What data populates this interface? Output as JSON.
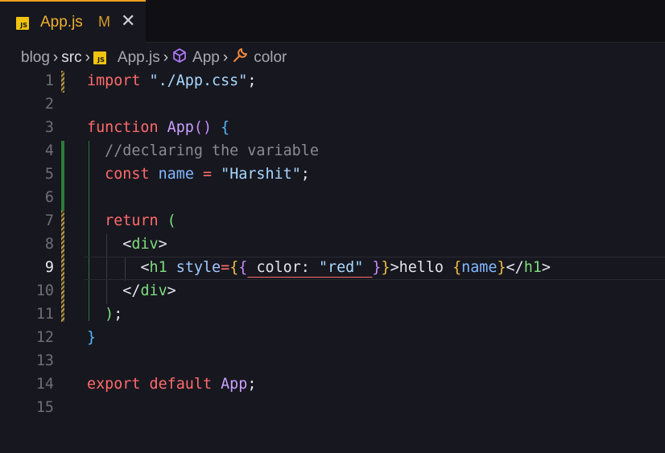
{
  "tab": {
    "icon": "JS",
    "label": "App.js",
    "status": "M",
    "close": "✕"
  },
  "breadcrumb": {
    "items": [
      "blog",
      "src",
      "App.js",
      "App",
      "color"
    ]
  },
  "editor": {
    "active_line": 9,
    "lines": [
      {
        "n": "1",
        "text": "import \"./App.css\";"
      },
      {
        "n": "2",
        "text": ""
      },
      {
        "n": "3",
        "text": "function App() {"
      },
      {
        "n": "4",
        "text": "  //declaring the variable"
      },
      {
        "n": "5",
        "text": "  const name = \"Harshit\";"
      },
      {
        "n": "6",
        "text": ""
      },
      {
        "n": "7",
        "text": "  return ("
      },
      {
        "n": "8",
        "text": "    <div>"
      },
      {
        "n": "9",
        "text": "      <h1 style={{ color: \"red\" }}>hello {name}</h1>"
      },
      {
        "n": "10",
        "text": "    </div>"
      },
      {
        "n": "11",
        "text": "  );"
      },
      {
        "n": "12",
        "text": "}"
      },
      {
        "n": "13",
        "text": ""
      },
      {
        "n": "14",
        "text": "export default App;"
      },
      {
        "n": "15",
        "text": ""
      }
    ]
  },
  "colors": {
    "background": "#17171f",
    "tab_accent": "#f0a020",
    "keyword": "#ff6b6b",
    "string": "#a8d8ff",
    "function": "#c9a0ff",
    "tag": "#7ddc7d"
  }
}
